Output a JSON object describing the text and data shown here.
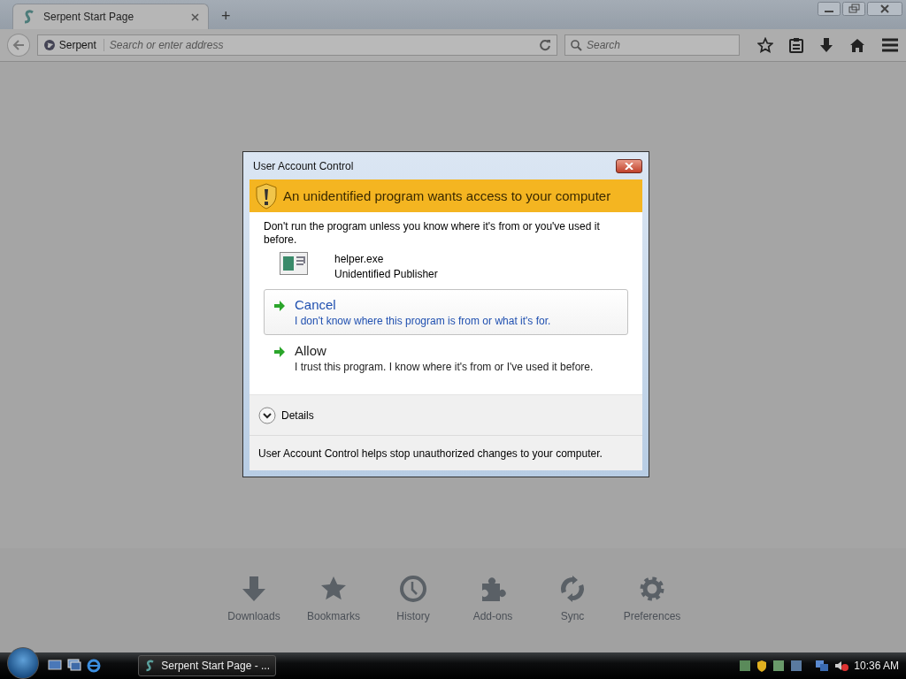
{
  "browser": {
    "tab": {
      "title": "Serpent Start Page",
      "selected": true
    },
    "new_tab": "+",
    "identity": "Serpent",
    "address": {
      "placeholder": "Search or enter address"
    },
    "search": {
      "placeholder": "Search"
    }
  },
  "launcher": [
    {
      "kind": "downloads",
      "label": "Downloads"
    },
    {
      "kind": "bookmarks",
      "label": "Bookmarks"
    },
    {
      "kind": "history",
      "label": "History"
    },
    {
      "kind": "addons",
      "label": "Add-ons"
    },
    {
      "kind": "sync",
      "label": "Sync"
    },
    {
      "kind": "preferences",
      "label": "Preferences"
    }
  ],
  "dialog": {
    "title": "User Account Control",
    "header": "An unidentified program wants access to your computer",
    "message": "Don't run the program unless you know where it's from or you've used it before.",
    "program": {
      "name": "helper.exe",
      "publisher": "Unidentified Publisher"
    },
    "options": [
      {
        "title": "Cancel",
        "description": "I don't know where this program is from or what it's for.",
        "selected": true
      },
      {
        "title": "Allow",
        "description": "I trust this program. I know where it's from or I've used it before.",
        "selected": false
      }
    ],
    "details": {
      "label": "Details",
      "expanded": false
    },
    "footer": "User Account Control helps stop unauthorized changes to your computer."
  },
  "taskbar": {
    "task": "Serpent Start Page - ...",
    "clock": "10:36 AM"
  }
}
